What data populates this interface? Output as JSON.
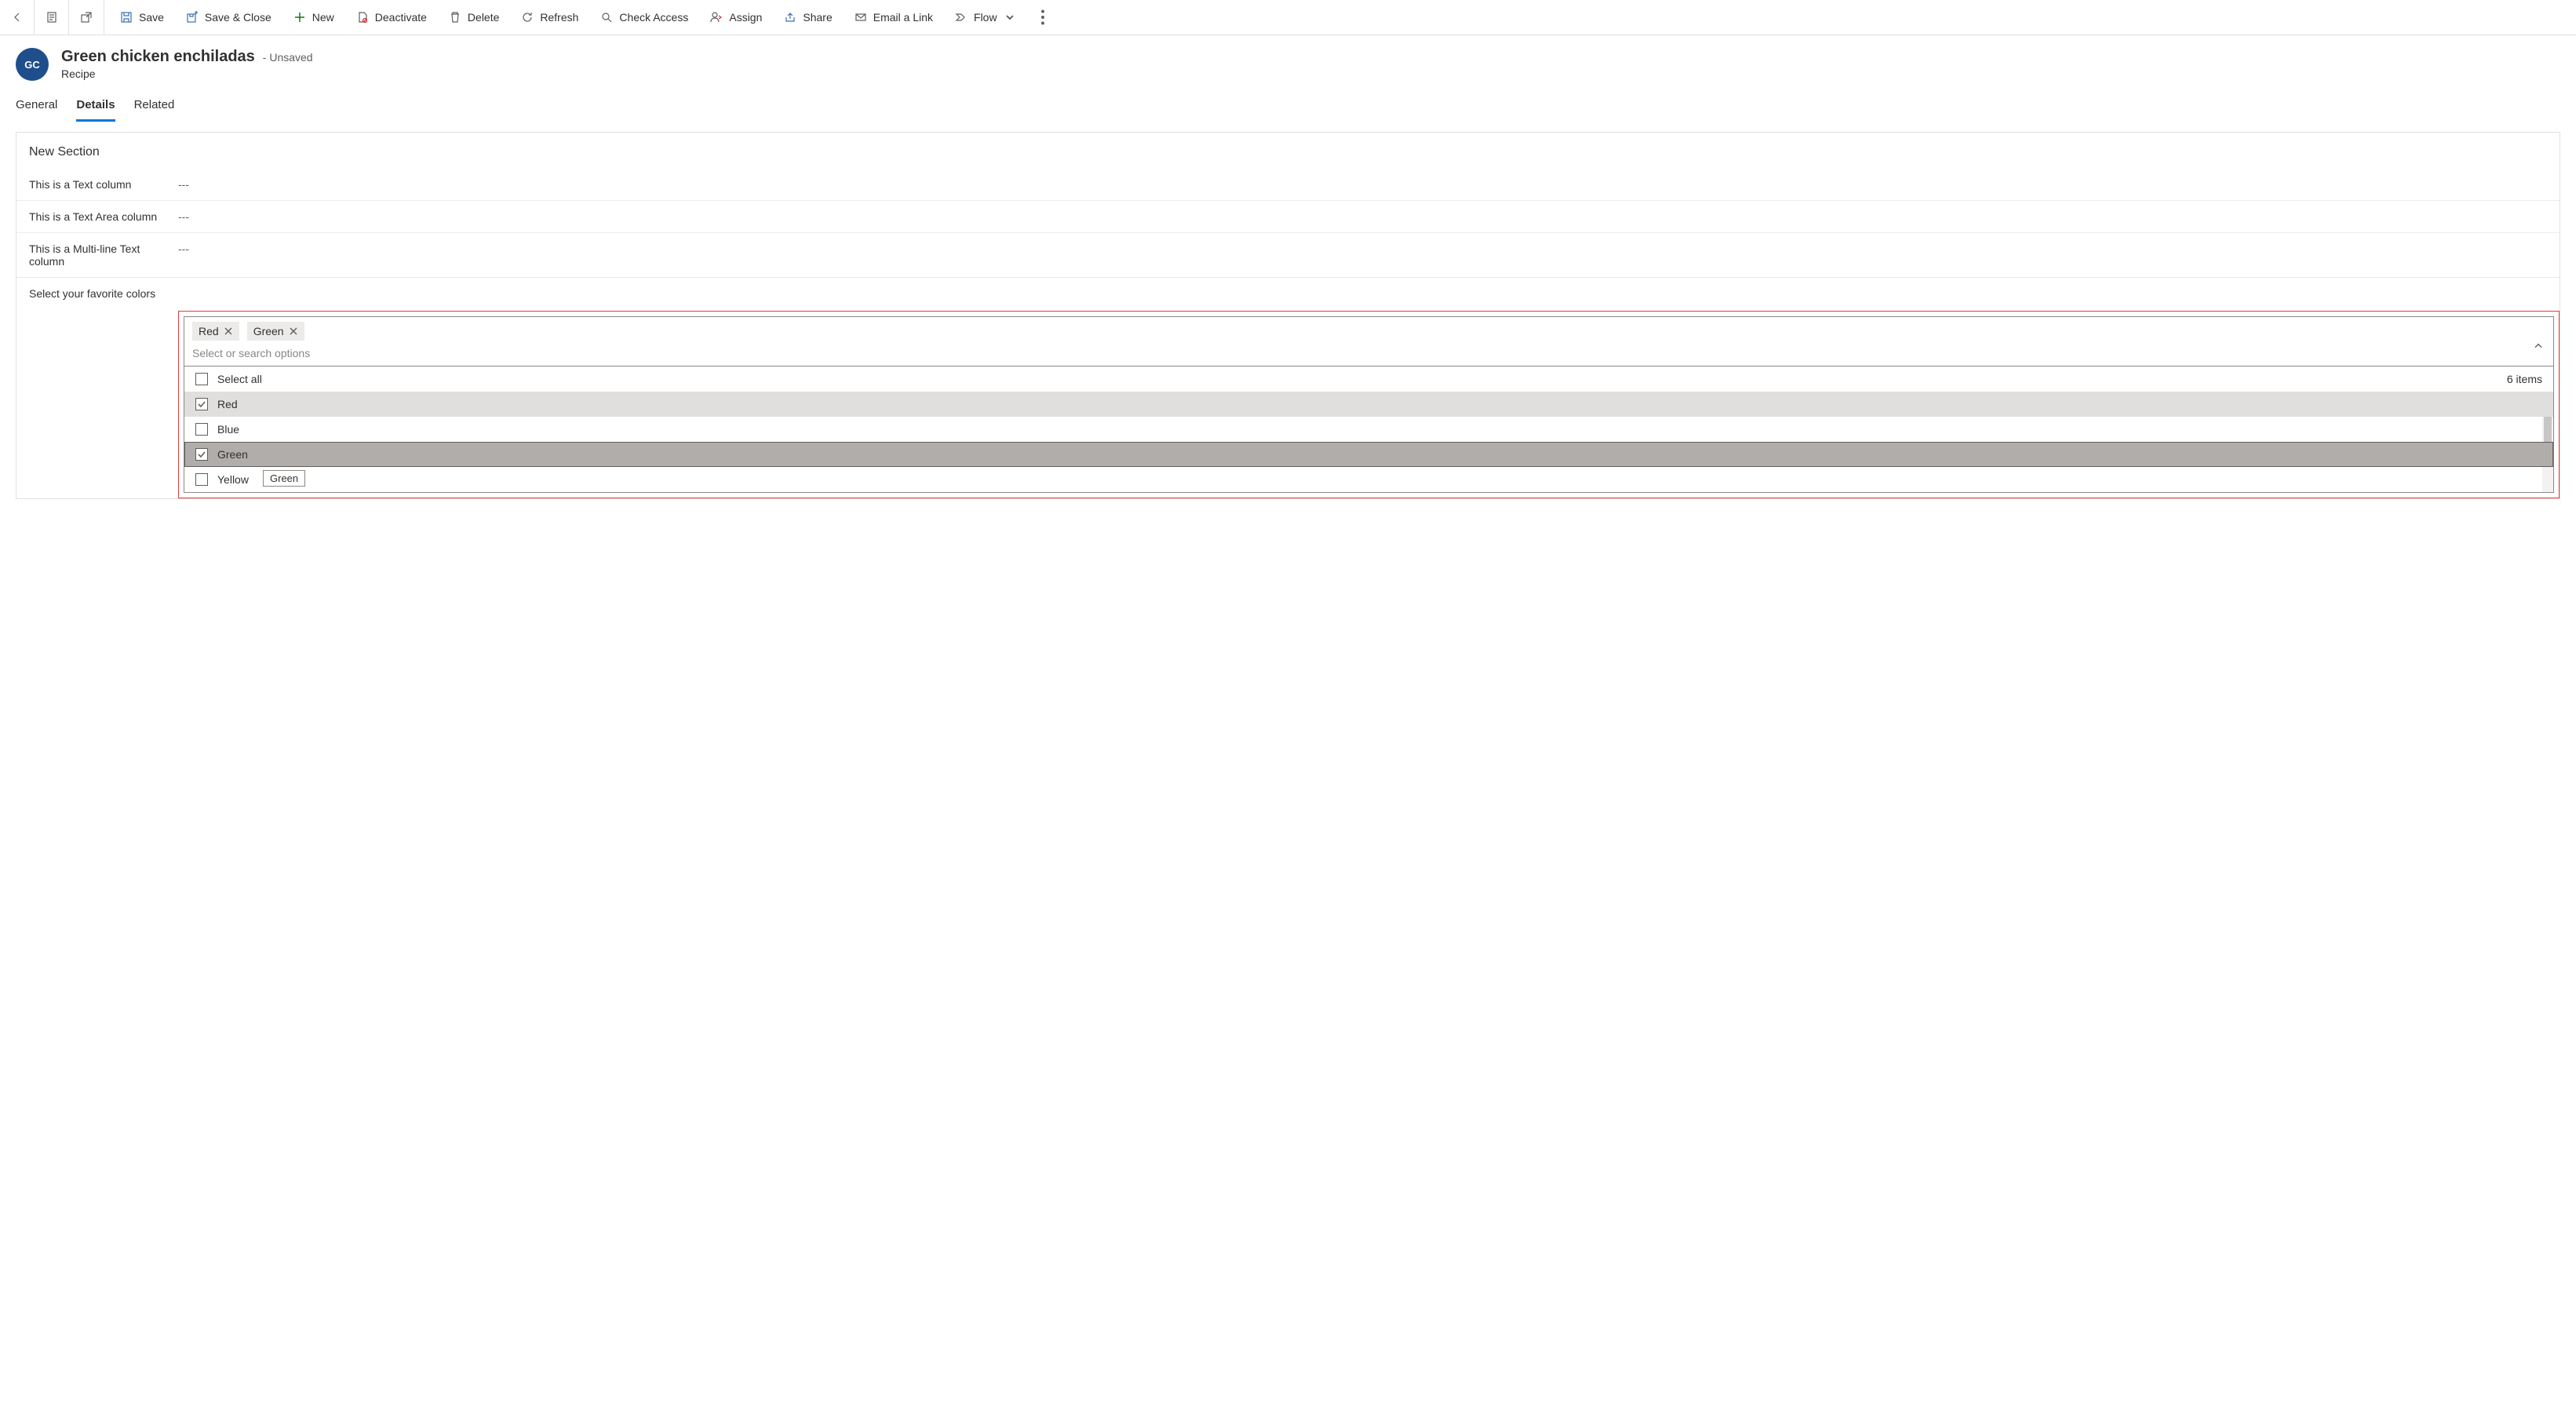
{
  "cmd": {
    "save": "Save",
    "save_close": "Save & Close",
    "new": "New",
    "deactivate": "Deactivate",
    "delete": "Delete",
    "refresh": "Refresh",
    "check_access": "Check Access",
    "assign": "Assign",
    "share": "Share",
    "email_link": "Email a Link",
    "flow": "Flow"
  },
  "header": {
    "avatar_initials": "GC",
    "title": "Green chicken enchiladas",
    "saved_state": "- Unsaved",
    "subtitle": "Recipe"
  },
  "tabs": {
    "general": "General",
    "details": "Details",
    "related": "Related",
    "active": "details"
  },
  "section": {
    "title": "New Section",
    "fields": {
      "text_col": {
        "label": "This is a Text column",
        "value": "---"
      },
      "text_area_col": {
        "label": "This is a Text Area column",
        "value": "---"
      },
      "multiline_col": {
        "label": "This is a Multi-line Text column",
        "value": "---"
      },
      "fav_colors": {
        "label": "Select your favorite colors"
      }
    }
  },
  "combo": {
    "placeholder": "Select or search options",
    "chips": [
      "Red",
      "Green"
    ],
    "select_all_label": "Select all",
    "item_count_label": "6 items",
    "options": [
      {
        "label": "Red",
        "checked": true,
        "state": "selected"
      },
      {
        "label": "Blue",
        "checked": false,
        "state": ""
      },
      {
        "label": "Green",
        "checked": true,
        "state": "hovered"
      },
      {
        "label": "Yellow",
        "checked": false,
        "state": ""
      }
    ],
    "tooltip": "Green"
  }
}
